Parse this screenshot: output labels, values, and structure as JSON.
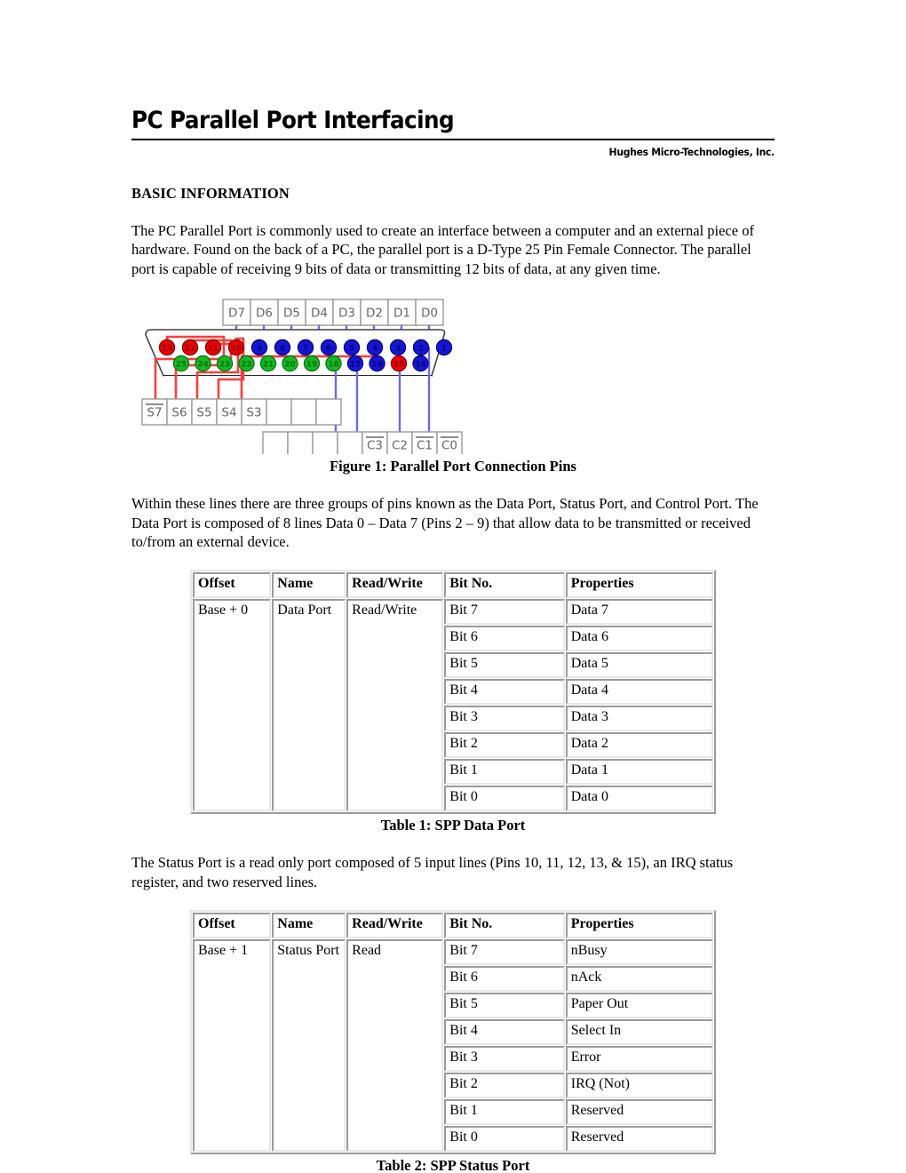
{
  "header": {
    "title": "PC Parallel Port Interfacing",
    "company": "Hughes Micro-Technologies, Inc."
  },
  "sections": {
    "basic_information_heading": "BASIC INFORMATION",
    "intro_paragraph": "The PC Parallel Port is commonly used to create an interface between a computer and an external piece of hardware.  Found on the back of a PC, the parallel port is a D-Type 25 Pin Female Connector.  The parallel port is capable of receiving 9 bits of data or transmitting 12 bits of data, at any given time.",
    "data_port_paragraph": "Within these lines there are three groups of pins known as the Data Port, Status Port, and Control Port.  The Data Port is composed of 8 lines Data 0 – Data 7 (Pins 2 – 9) that allow data to be transmitted or received to/from an external device.",
    "status_port_paragraph": "The Status Port is a read only port composed of 5 input lines (Pins 10, 11, 12, 13, & 15), an IRQ status register, and two reserved lines."
  },
  "figure": {
    "caption": "Figure 1: Parallel Port Connection Pins",
    "data_labels": [
      "D7",
      "D6",
      "D5",
      "D4",
      "D3",
      "D2",
      "D1",
      "D0"
    ],
    "status_labels": [
      "S7",
      "S6",
      "S5",
      "S4",
      "S3",
      "",
      "",
      ""
    ],
    "status_overline": [
      true,
      false,
      false,
      false,
      false,
      false,
      false,
      false
    ],
    "control_labels": [
      "",
      "",
      "",
      "",
      "C3",
      "C2",
      "C1",
      "C0"
    ],
    "control_overline": [
      false,
      false,
      false,
      false,
      true,
      false,
      true,
      true
    ],
    "top_row_pins": [
      {
        "n": "13",
        "color": "red"
      },
      {
        "n": "12",
        "color": "red"
      },
      {
        "n": "11",
        "color": "red"
      },
      {
        "n": "10",
        "color": "red"
      },
      {
        "n": "9",
        "color": "blue"
      },
      {
        "n": "8",
        "color": "blue"
      },
      {
        "n": "7",
        "color": "blue"
      },
      {
        "n": "6",
        "color": "blue"
      },
      {
        "n": "5",
        "color": "blue"
      },
      {
        "n": "4",
        "color": "blue"
      },
      {
        "n": "3",
        "color": "blue"
      },
      {
        "n": "2",
        "color": "blue"
      },
      {
        "n": "1",
        "color": "blue"
      }
    ],
    "bottom_row_pins": [
      {
        "n": "25",
        "color": "green"
      },
      {
        "n": "24",
        "color": "green"
      },
      {
        "n": "23",
        "color": "green"
      },
      {
        "n": "22",
        "color": "green"
      },
      {
        "n": "21",
        "color": "green"
      },
      {
        "n": "20",
        "color": "green"
      },
      {
        "n": "19",
        "color": "green"
      },
      {
        "n": "18",
        "color": "green"
      },
      {
        "n": "17",
        "color": "blue"
      },
      {
        "n": "16",
        "color": "blue"
      },
      {
        "n": "15",
        "color": "red"
      },
      {
        "n": "14",
        "color": "blue"
      }
    ],
    "colors": {
      "pin_red": "#ee0000",
      "pin_blue": "#1515d5",
      "pin_green": "#11bb22",
      "wire_red": "#ff3b3b",
      "wire_blue": "#6a6aee",
      "box_border": "#999999",
      "box_text": "#666666",
      "shell": "#000000"
    }
  },
  "table1": {
    "caption": "Table 1: SPP Data Port",
    "headers": [
      "Offset",
      "Name",
      "Read/Write",
      "Bit No.",
      "Properties"
    ],
    "offset": "Base + 0",
    "name": "Data Port",
    "read_write": "Read/Write",
    "rows": [
      {
        "bit": "Bit 7",
        "property": "Data 7"
      },
      {
        "bit": "Bit 6",
        "property": "Data 6"
      },
      {
        "bit": "Bit 5",
        "property": "Data 5"
      },
      {
        "bit": "Bit 4",
        "property": "Data 4"
      },
      {
        "bit": "Bit 3",
        "property": "Data 3"
      },
      {
        "bit": "Bit 2",
        "property": "Data 2"
      },
      {
        "bit": "Bit 1",
        "property": "Data 1"
      },
      {
        "bit": "Bit 0",
        "property": "Data 0"
      }
    ]
  },
  "table2": {
    "caption": "Table 2: SPP Status Port",
    "headers": [
      "Offset",
      "Name",
      "Read/Write",
      "Bit No.",
      "Properties"
    ],
    "offset": "Base + 1",
    "name": "Status Port",
    "read_write": "Read",
    "rows": [
      {
        "bit": "Bit 7",
        "property": "nBusy"
      },
      {
        "bit": "Bit 6",
        "property": "nAck"
      },
      {
        "bit": "Bit 5",
        "property": "Paper Out"
      },
      {
        "bit": "Bit 4",
        "property": "Select In"
      },
      {
        "bit": "Bit 3",
        "property": "Error"
      },
      {
        "bit": "Bit 2",
        "property": "IRQ (Not)"
      },
      {
        "bit": "Bit 1",
        "property": "Reserved"
      },
      {
        "bit": "Bit 0",
        "property": "Reserved"
      }
    ]
  }
}
